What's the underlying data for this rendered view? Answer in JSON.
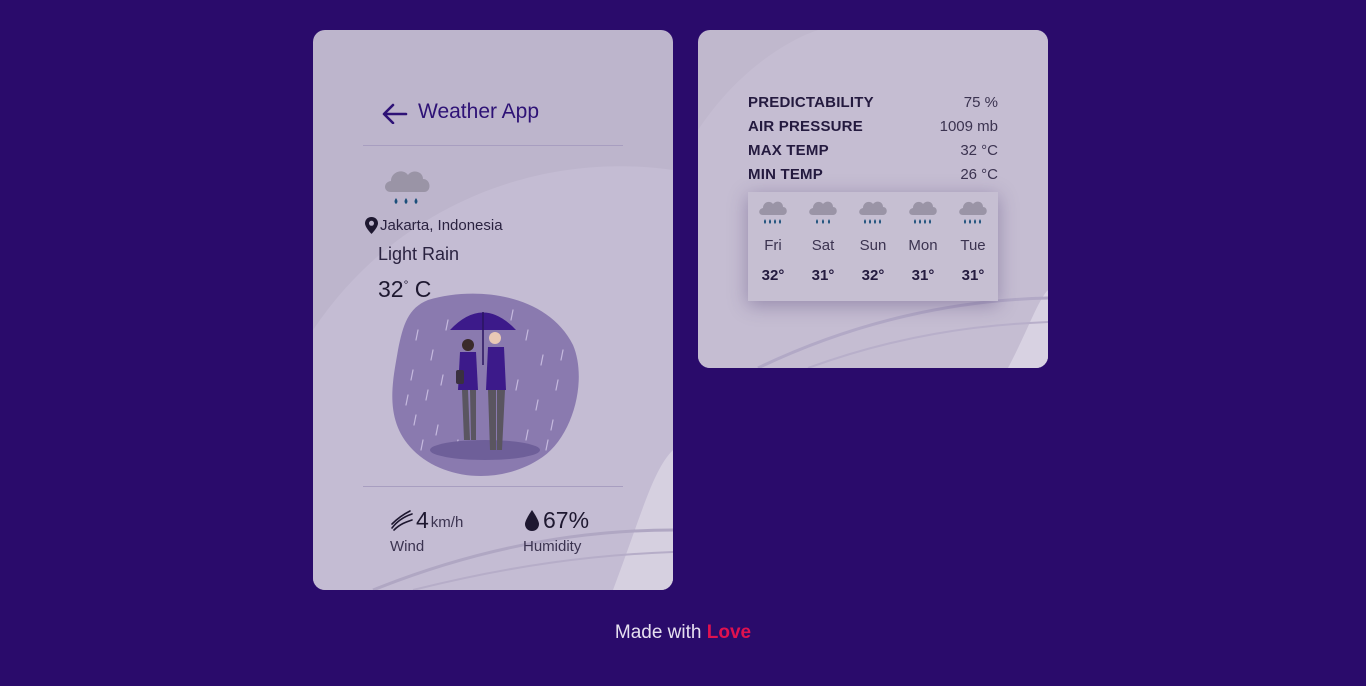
{
  "app": {
    "title": "Weather App"
  },
  "current": {
    "location": "Jakarta, Indonesia",
    "condition": "Light Rain",
    "temp_value": "32",
    "temp_unit": "C",
    "icon": "rain-cloud-icon"
  },
  "stats": {
    "wind_value": "4",
    "wind_unit": "km/h",
    "wind_label": "Wind",
    "humidity_value": "67%",
    "humidity_label": "Humidity"
  },
  "details": [
    {
      "label": "PREDICTABILITY",
      "value": "75 %"
    },
    {
      "label": "AIR PRESSURE",
      "value": "1009 mb"
    },
    {
      "label": "MAX TEMP",
      "value": "32 °C"
    },
    {
      "label": "MIN TEMP",
      "value": "26 °C"
    }
  ],
  "forecast": [
    {
      "day": "Fri",
      "temp": "32°",
      "icon": "heavy-rain-cloud-icon"
    },
    {
      "day": "Sat",
      "temp": "31°",
      "icon": "light-rain-cloud-icon"
    },
    {
      "day": "Sun",
      "temp": "32°",
      "icon": "heavy-rain-cloud-icon"
    },
    {
      "day": "Mon",
      "temp": "31°",
      "icon": "heavy-rain-cloud-icon"
    },
    {
      "day": "Tue",
      "temp": "31°",
      "icon": "heavy-rain-cloud-icon"
    }
  ],
  "footer": {
    "prefix": "Made with",
    "highlight": "Love"
  },
  "colors": {
    "background": "#2a0b6b",
    "accent": "#2e1276",
    "love": "#e0114f"
  }
}
